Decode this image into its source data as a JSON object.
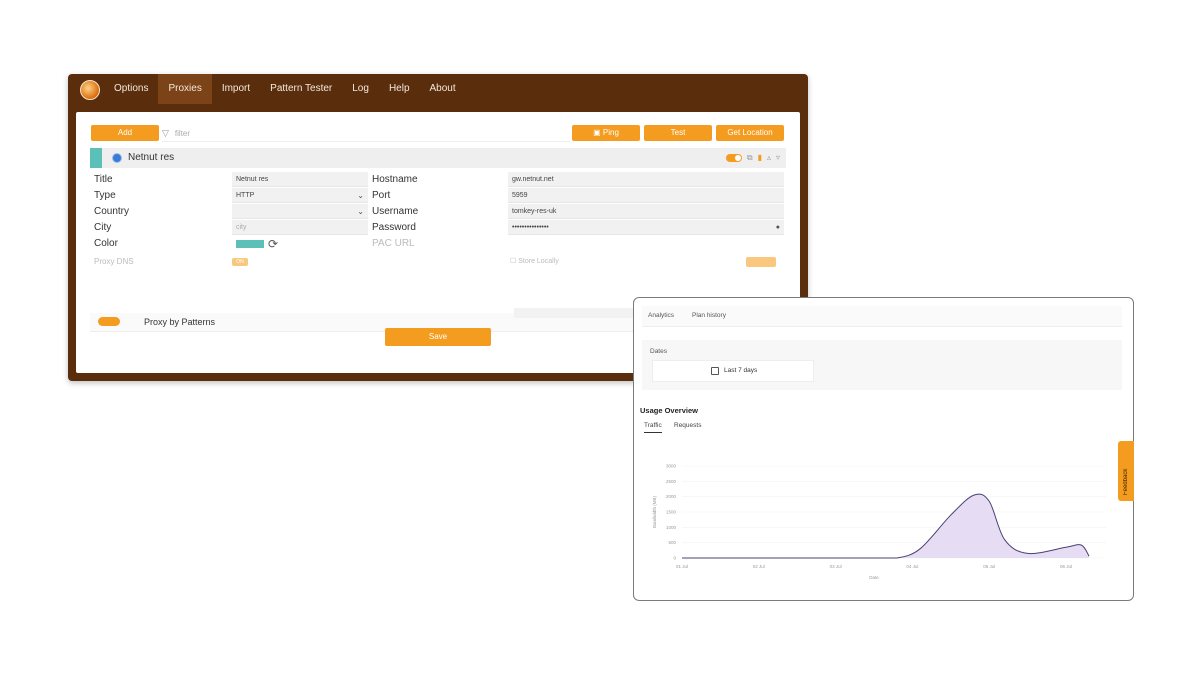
{
  "menubar": {
    "items": [
      "Options",
      "Proxies",
      "Import",
      "Pattern Tester",
      "Log",
      "Help",
      "About"
    ],
    "active": "Proxies"
  },
  "toolbar": {
    "add_label": "Add",
    "filter_placeholder": "filter",
    "ping_label": "Ping",
    "test_label": "Test",
    "get_location_label": "Get Location"
  },
  "proxy": {
    "header_title": "Netnut res",
    "color": "#5cc0b8",
    "labels": {
      "title": "Title",
      "type": "Type",
      "country": "Country",
      "city": "City",
      "color": "Color",
      "proxy_dns": "Proxy DNS",
      "hostname": "Hostname",
      "port": "Port",
      "username": "Username",
      "password": "Password",
      "pac_url": "PAC URL",
      "store_locally": "Store Locally"
    },
    "values": {
      "title": "Netnut res",
      "type": "HTTP",
      "country": "",
      "city_placeholder": "city",
      "hostname": "gw.netnut.net",
      "port": "5959",
      "username": "tomkey-res-uk",
      "password": "•••••••••••••••",
      "proxy_dns_toggle": "ON"
    },
    "pattern_label": "Proxy by Patterns",
    "pattern_toggle": "ON"
  },
  "save_label": "Save",
  "analytics": {
    "tabs": [
      "Analytics",
      "Plan history"
    ],
    "date_label": "Dates",
    "date_value": "Last 7 days",
    "usage_title": "Usage Overview",
    "usage_tabs": [
      "Traffic",
      "Requests"
    ],
    "active_usage_tab": "Traffic",
    "feedback_label": "Feedback"
  },
  "chart_data": {
    "type": "area",
    "title": "",
    "xlabel": "Date",
    "ylabel": "Bandwidth (MB)",
    "x_ticks": [
      "01 Jul",
      "02 Jul",
      "03 Jul",
      "04 Jul",
      "05 Jul",
      "06 Jul"
    ],
    "y_ticks": [
      "0",
      "500",
      "1000",
      "1500",
      "2000",
      "2500",
      "3000"
    ],
    "ylim": [
      0,
      3000
    ],
    "x": [
      0,
      0.5,
      1,
      1.5,
      2,
      2.5,
      2.8,
      3.1,
      3.5,
      3.8,
      4.0,
      4.2,
      4.5,
      5.0,
      5.2,
      5.3
    ],
    "values": [
      0,
      0,
      0,
      0,
      0,
      0,
      0,
      300,
      1400,
      2050,
      1850,
      600,
      150,
      350,
      420,
      60
    ],
    "line_color": "#4b3f72",
    "fill_color": "#e6dcf4"
  }
}
